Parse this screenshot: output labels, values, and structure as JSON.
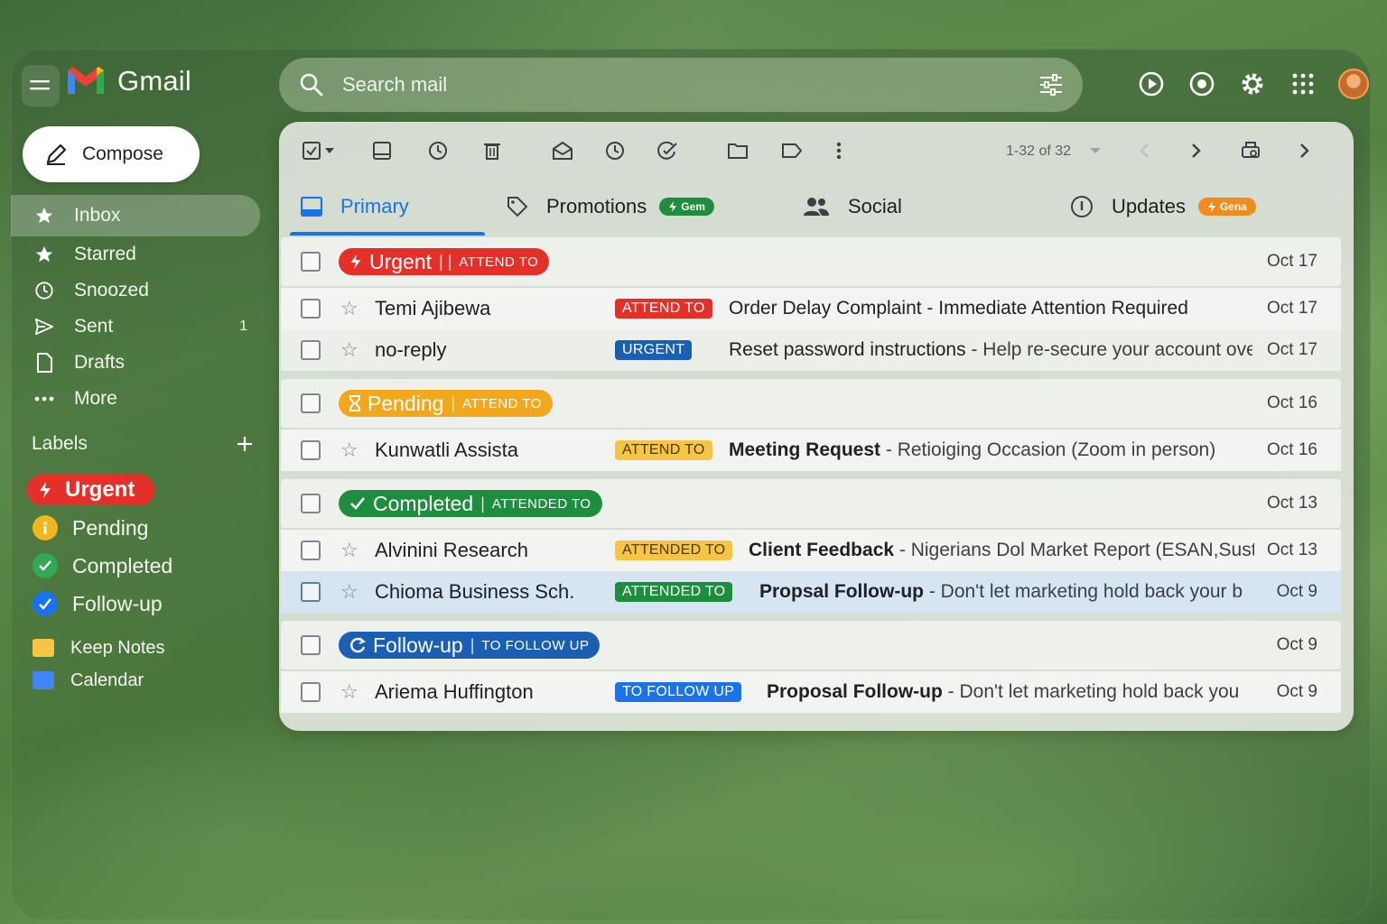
{
  "app": {
    "name": "Gmail"
  },
  "search": {
    "placeholder": "Search mail"
  },
  "sidebar": {
    "compose_label": "Compose",
    "items": [
      {
        "label": "Inbox",
        "icon": "star-icon",
        "count": ""
      },
      {
        "label": "Starred",
        "icon": "star-icon",
        "count": ""
      },
      {
        "label": "Snoozed",
        "icon": "clock-icon",
        "count": ""
      },
      {
        "label": "Sent",
        "icon": "send-icon",
        "count": "1"
      },
      {
        "label": "Drafts",
        "icon": "file-icon",
        "count": ""
      },
      {
        "label": "More",
        "icon": "more-icon",
        "count": ""
      }
    ],
    "labels_heading": "Labels",
    "labels": [
      {
        "label": "Urgent",
        "color": "#e5302a"
      },
      {
        "label": "Pending",
        "color": "#f2b51d"
      },
      {
        "label": "Completed",
        "color": "#34a853"
      },
      {
        "label": "Follow-up",
        "color": "#1a73e8"
      }
    ],
    "apps": [
      {
        "label": "Keep Notes",
        "color": "#f7c545"
      },
      {
        "label": "Calendar",
        "color": "#4285f4"
      }
    ]
  },
  "toolbar": {
    "count_text": "1-32 of 32"
  },
  "tabs": [
    {
      "label": "Primary",
      "badge": ""
    },
    {
      "label": "Promotions",
      "badge": "Gem"
    },
    {
      "label": "Social",
      "badge": ""
    },
    {
      "label": "Updates",
      "badge": "Gena"
    }
  ],
  "groups": [
    {
      "name": "Urgent",
      "sep": "| |",
      "sub": "ATTEND TO",
      "date": "Oct 17"
    },
    {
      "name": "Pending",
      "sep": "|",
      "sub": "ATTEND TO",
      "date": "Oct 16"
    },
    {
      "name": "Completed",
      "sep": "|",
      "sub": "ATTENDED TO",
      "date": "Oct 13"
    },
    {
      "name": "Follow-up",
      "sep": "|",
      "sub": "TO FOLLOW UP",
      "date": "Oct 9"
    }
  ],
  "emails": [
    {
      "sender": "Temi Ajibewa",
      "tag": "ATTEND TO",
      "subject": "Order Delay Complaint - Immediate Attention Required",
      "snippet": "",
      "date": "Oct 17"
    },
    {
      "sender": "no-reply",
      "tag": "URGENT",
      "subject": "Reset password instructions",
      "snippet": " - Help re-secure your account ove...",
      "date": "Oct 17"
    },
    {
      "sender": "Kunwatli Assista",
      "tag": "ATTEND TO",
      "subject": "Meeting Request",
      "snippet": " - Retioiging Occasion (Zoom in person)",
      "date": "Oct 16"
    },
    {
      "sender": "Alvinini Research",
      "tag": "ATTENDED TO",
      "subject": "Client Feedback",
      "snippet": " - Nigerians Dol Market Report (ESAN,Sust...",
      "date": "Oct 13"
    },
    {
      "sender": "Chioma Business Sch.",
      "tag": "ATTENDED TO",
      "subject": "Propsal Follow-up",
      "snippet": " - Don't let marketing hold back your b",
      "date": "Oct 9"
    },
    {
      "sender": "Ariema Huffington",
      "tag": "TO FOLLOW UP",
      "subject": "Proposal Follow-up",
      "snippet": " - Don't let marketing hold back you",
      "date": "Oct 9"
    }
  ]
}
